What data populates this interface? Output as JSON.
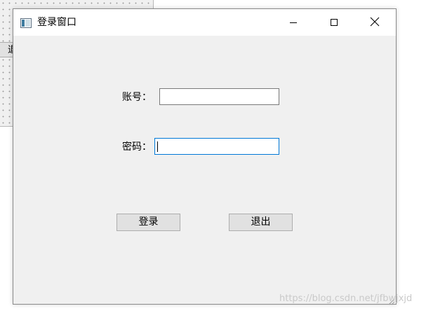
{
  "background_window": {
    "button_label": "退"
  },
  "window": {
    "title": "登录窗口",
    "icon": "app-window-icon",
    "controls": {
      "minimize_icon": "minimize-icon",
      "maximize_icon": "maximize-icon",
      "close_icon": "close-icon"
    }
  },
  "form": {
    "account": {
      "label": "账号：",
      "value": ""
    },
    "password": {
      "label": "密码：",
      "value": ""
    }
  },
  "buttons": {
    "login_label": "登录",
    "exit_label": "退出"
  },
  "watermark": "https://blog.csdn.net/jfbwjxjd",
  "colors": {
    "window_bg": "#f0f0f0",
    "titlebar_bg": "#ffffff",
    "focus_border": "#0078d7",
    "button_bg": "#e1e1e1"
  }
}
